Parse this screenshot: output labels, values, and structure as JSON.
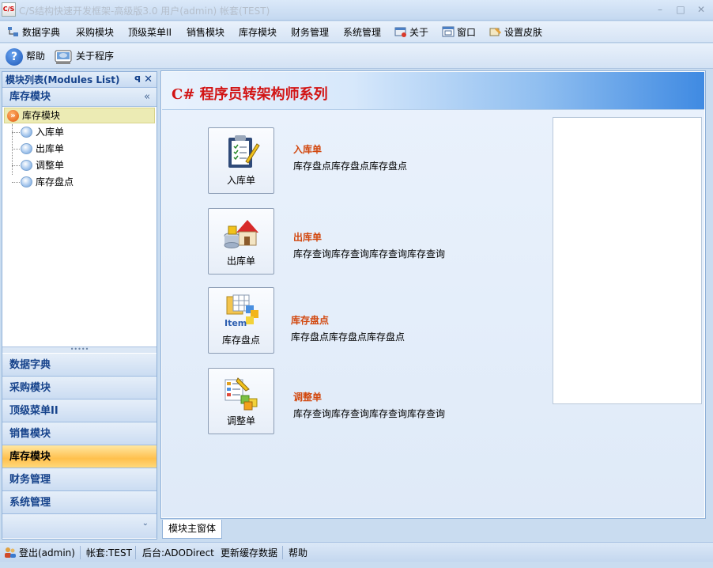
{
  "window": {
    "logo_text": "C/S",
    "title": "C/S结构快速开发框架-高级版3.0 用户(admin) 帐套(TEST)",
    "minimize": "–",
    "maximize": "□",
    "close": "✕"
  },
  "menu": {
    "items": [
      "数据字典",
      "采购模块",
      "顶级菜单II",
      "销售模块",
      "库存模块",
      "财务管理",
      "系统管理",
      "关于",
      "窗口",
      "设置皮肤"
    ]
  },
  "toolbar": {
    "help_icon": "?",
    "help_label": "帮助",
    "about_label": "关于程序"
  },
  "left_panel": {
    "title": "模块列表(Modules List)",
    "pin_icon": "ꟼ",
    "close_icon": "✕",
    "group_title": "库存模块",
    "collapse_icon": "«",
    "tree_root": "库存模块",
    "tree_root_icon": "»",
    "tree_items": [
      "入库单",
      "出库单",
      "调整单",
      "库存盘点"
    ],
    "splitter": "•••••",
    "nav_groups": [
      "数据字典",
      "采购模块",
      "顶级菜单II",
      "销售模块",
      "库存模块",
      "财务管理",
      "系统管理"
    ],
    "active_group": "库存模块",
    "footer_icon": "⌄"
  },
  "main": {
    "banner_title": "C# 程序员转架构师系列",
    "functions": [
      {
        "button_label": "入库单",
        "title": "入库单",
        "description": "库存盘点库存盘点库存盘点",
        "icon": "clipboard-icon"
      },
      {
        "button_label": "出库单",
        "title": "出库单",
        "description": "库存查询库存查询库存查询库存查询",
        "icon": "warehouse-icon"
      },
      {
        "button_label": "库存盘点",
        "title": "库存盘点",
        "description": "库存盘点库存盘点库存盘点",
        "icon": "item-icon",
        "icon_text": "Item"
      },
      {
        "button_label": "调整单",
        "title": "调整单",
        "description": "库存查询库存查询库存查询库存查询",
        "icon": "adjust-icon"
      }
    ]
  },
  "tabs": [
    "模块主窗体"
  ],
  "statusbar": {
    "logout": "登出(admin)",
    "account": "帐套:TEST",
    "backend": "后台:ADODirect",
    "refresh": "更新缓存数据",
    "help": "帮助"
  },
  "colors": {
    "accent_title": "#d21414",
    "function_title": "#d2480f",
    "active_nav": "#ffc04d",
    "tree_selected": "#ecebb4"
  }
}
